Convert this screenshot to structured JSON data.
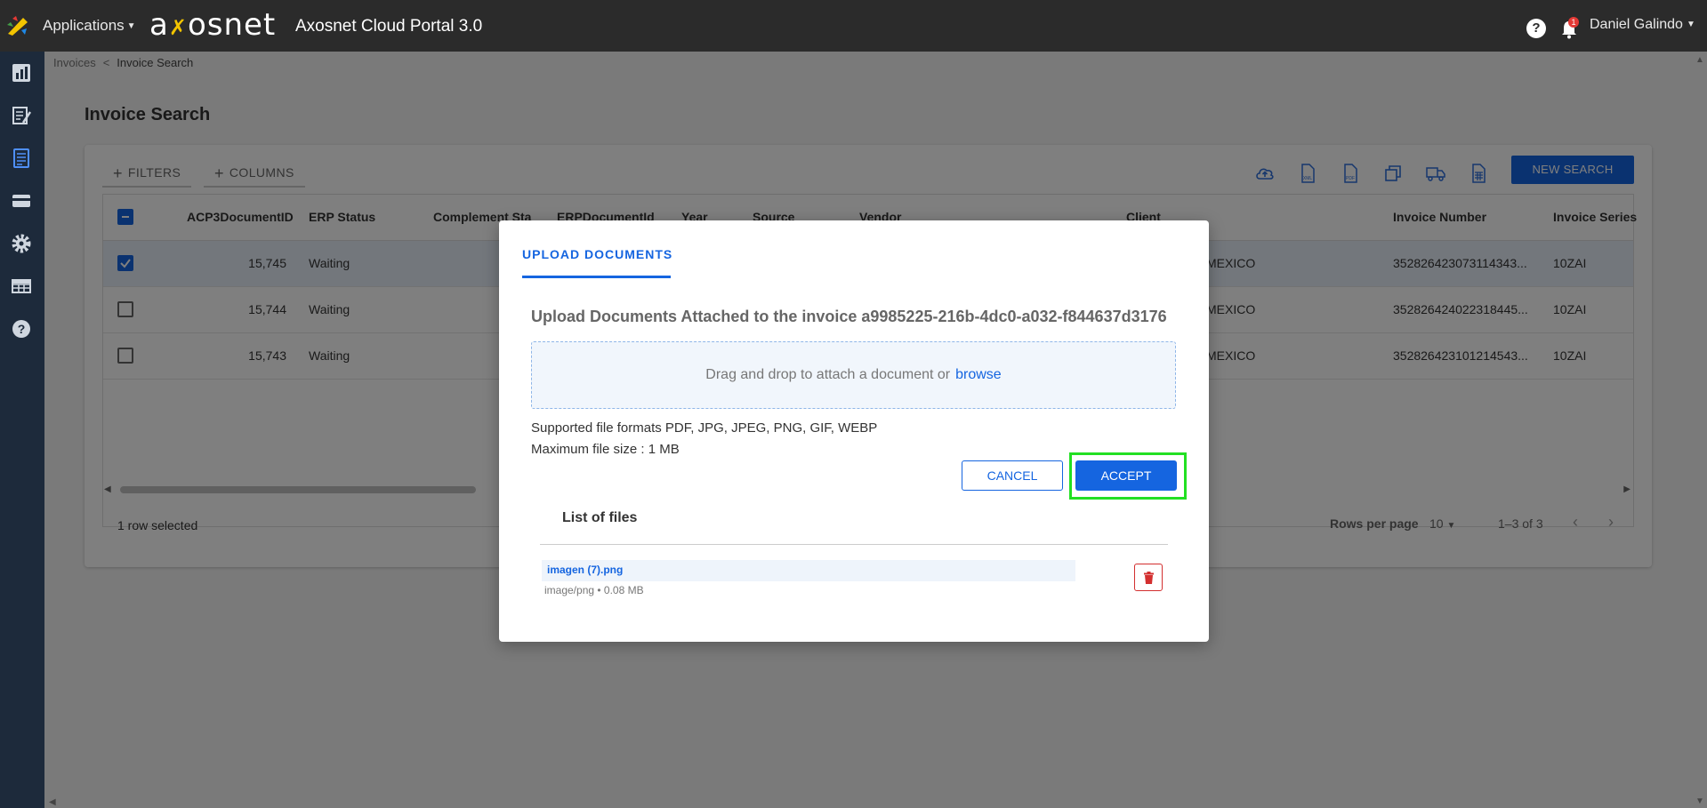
{
  "topbar": {
    "apps_label": "Applications",
    "logo_text": "axosnet",
    "portal_title": "Axosnet Cloud Portal 3.0",
    "help_label": "?",
    "notification_count": "1",
    "user_name": "Daniel Galindo"
  },
  "sidebar": {
    "items": [
      "dashboard-icon",
      "invoices-pen-icon",
      "document-icon",
      "card-icon",
      "gear-icon",
      "table-icon",
      "help-icon"
    ]
  },
  "breadcrumb": {
    "parent": "Invoices",
    "separator": "<",
    "current": "Invoice Search"
  },
  "page": {
    "title": "Invoice Search"
  },
  "toolbar": {
    "filters_label": "FILTERS",
    "columns_label": "COLUMNS",
    "new_search_label": "NEW SEARCH",
    "icons": [
      "cloud-upload-icon",
      "xml-file-icon",
      "pdf-file-icon",
      "copy-icon",
      "truck-icon",
      "spreadsheet-icon"
    ]
  },
  "grid": {
    "columns": [
      "ACP3DocumentID",
      "ERP Status",
      "Complement Sta",
      "ERPDocumentId",
      "Year",
      "Source",
      "Vendor",
      "Client",
      "Invoice Number",
      "Invoice Series"
    ],
    "rows": [
      {
        "selected": true,
        "id": "15,745",
        "status": "Waiting",
        "client": "MEXICO",
        "invoice_number": "352826423073114343...",
        "series": "10ZAI"
      },
      {
        "selected": false,
        "id": "15,744",
        "status": "Waiting",
        "client": "MEXICO",
        "invoice_number": "352826424022318445...",
        "series": "10ZAI"
      },
      {
        "selected": false,
        "id": "15,743",
        "status": "Waiting",
        "client": "MEXICO",
        "invoice_number": "352826423101214543...",
        "series": "10ZAI"
      }
    ],
    "footer": {
      "selected_text": "1 row selected",
      "rows_per_page_label": "Rows per page",
      "rows_per_page_value": "10",
      "range_text": "1–3 of 3"
    }
  },
  "modal": {
    "tab_label": "UPLOAD DOCUMENTS",
    "title": "Upload Documents Attached to the invoice a9985225-216b-4dc0-a032-f844637d3176",
    "dropzone_text": "Drag and drop to attach a document or",
    "browse_label": "browse",
    "formats_text": "Supported file formats PDF, JPG, JPEG, PNG, GIF, WEBP",
    "max_size_text": "Maximum file size : 1 MB",
    "cancel_label": "CANCEL",
    "accept_label": "ACCEPT",
    "list_title": "List of files",
    "files": [
      {
        "name": "imagen (7).png",
        "meta": "image/png • 0.08 MB"
      }
    ]
  },
  "colors": {
    "accent": "#1565e0",
    "topbar": "#2b2b2b",
    "sidebar": "#1d2a3b",
    "highlight": "#22e022",
    "danger": "#d32f2f"
  }
}
